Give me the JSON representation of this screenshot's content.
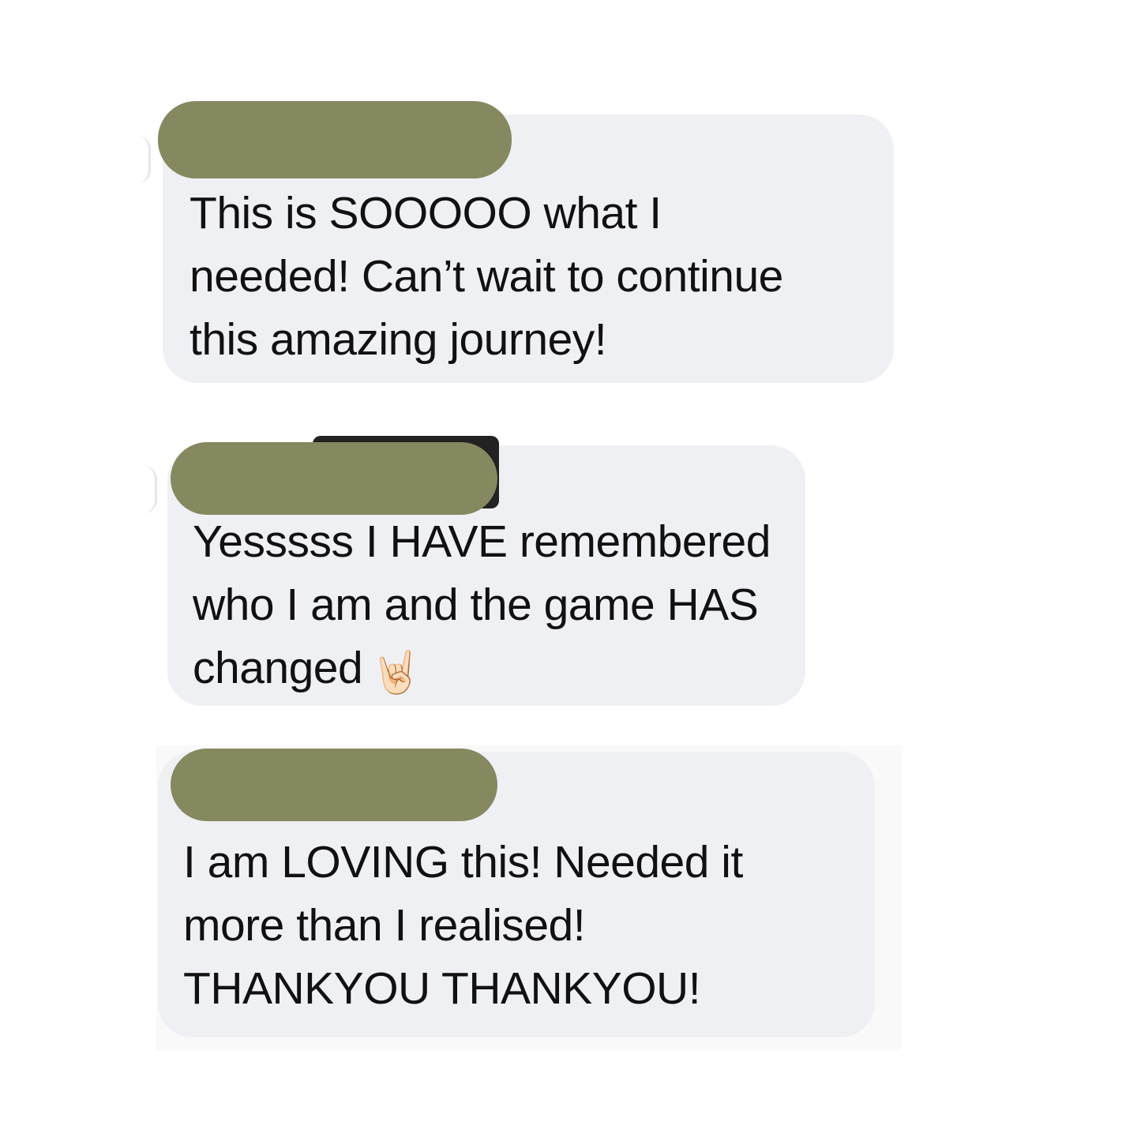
{
  "messages": [
    {
      "text_lines": "This is SOOOOO what I\nneeded! Can’t wait to continue\nthis amazing journey!",
      "sender_redacted": true
    },
    {
      "text_lines": "Yesssss I HAVE remembered\nwho I am and the game HAS\nchanged",
      "emoji": "🤘🏻",
      "emoji_name": "sign-of-the-horns",
      "sender_redacted": true
    },
    {
      "text_lines": "I am LOVING this! Needed it\nmore than I realised!\nTHANKYOU THANKYOU!",
      "sender_redacted": true
    }
  ],
  "colors": {
    "bubble_bg": "#eff0f4",
    "redaction": "#868860",
    "text": "#111111",
    "page_bg": "#ffffff"
  }
}
